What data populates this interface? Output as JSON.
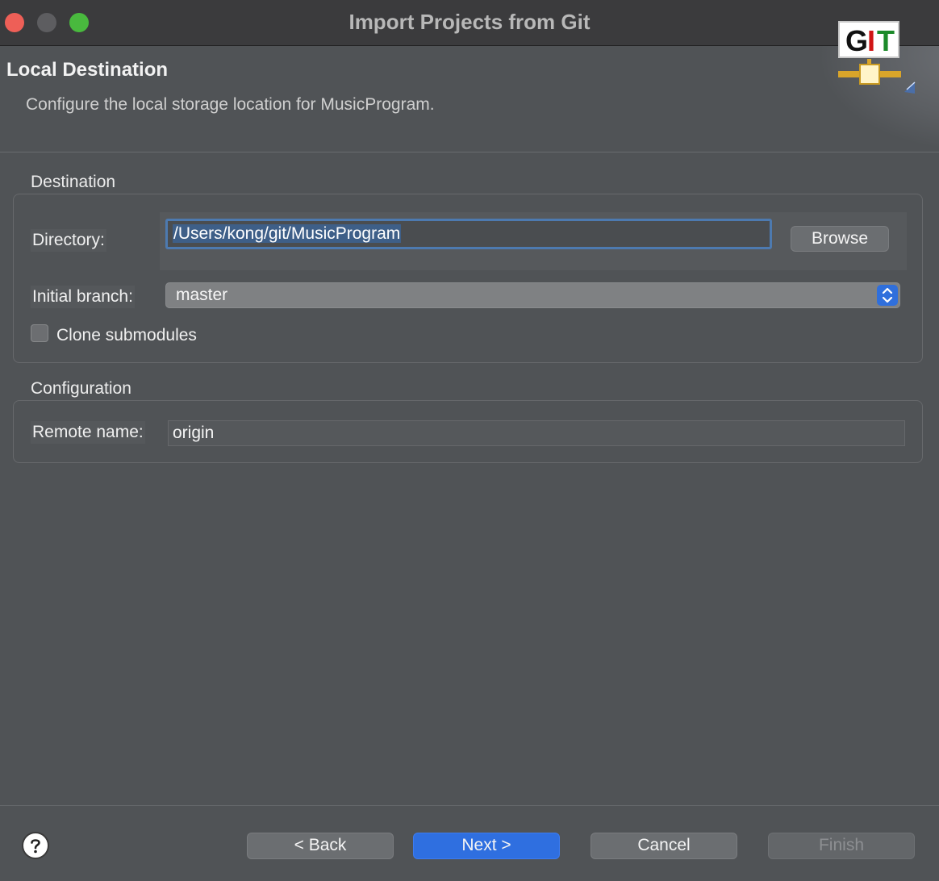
{
  "window": {
    "title": "Import Projects from Git"
  },
  "banner": {
    "title": "Local Destination",
    "description": "Configure the local storage location for MusicProgram.",
    "logo_text": "GIT"
  },
  "destination": {
    "group_label": "Destination",
    "directory_label": "Directory:",
    "directory_value": "/Users/kong/git/MusicProgram",
    "browse_label": "Browse",
    "initial_branch_label": "Initial branch:",
    "initial_branch_value": "master",
    "clone_submodules_label": "Clone submodules",
    "clone_submodules_checked": false
  },
  "configuration": {
    "group_label": "Configuration",
    "remote_name_label": "Remote name:",
    "remote_name_value": "origin"
  },
  "footer": {
    "back_label": "< Back",
    "next_label": "Next >",
    "cancel_label": "Cancel",
    "finish_label": "Finish"
  },
  "colors": {
    "accent": "#2f6fe0",
    "background": "#505356"
  }
}
